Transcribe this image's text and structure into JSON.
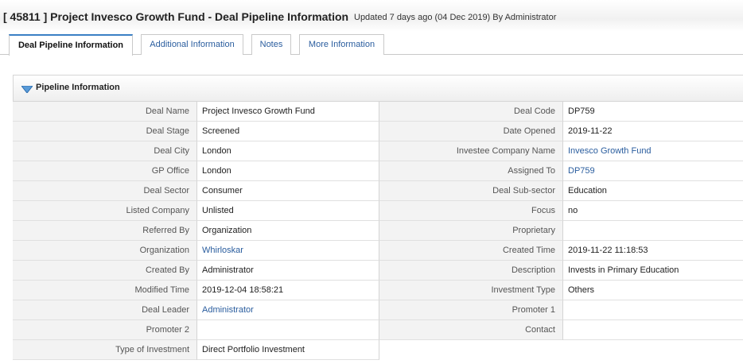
{
  "header": {
    "title": "[ 45811 ] Project Invesco Growth Fund - Deal Pipeline Information",
    "updated": "Updated 7 days ago (04 Dec 2019) By Administrator"
  },
  "tabs": [
    {
      "label": "Deal Pipeline Information"
    },
    {
      "label": "Additional Information"
    },
    {
      "label": "Notes"
    },
    {
      "label": "More Information"
    }
  ],
  "section": {
    "title": "Pipeline Information",
    "icon": "collapse-triangle-icon"
  },
  "rows": [
    {
      "l1": "Deal Name",
      "v1": "Project Invesco Growth Fund",
      "l2": "Deal Code",
      "v2": "DP759"
    },
    {
      "l1": "Deal Stage",
      "v1": "Screened",
      "l2": "Date Opened",
      "v2": "2019-11-22"
    },
    {
      "l1": "Deal City",
      "v1": "London",
      "l2": "Investee Company Name",
      "v2": "Invesco Growth Fund"
    },
    {
      "l1": "GP Office",
      "v1": "London",
      "l2": "Assigned To",
      "v2": "DP759"
    },
    {
      "l1": "Deal Sector",
      "v1": "Consumer",
      "l2": "Deal Sub-sector",
      "v2": "Education"
    },
    {
      "l1": "Listed Company",
      "v1": "Unlisted",
      "l2": "Focus",
      "v2": "no"
    },
    {
      "l1": "Referred By",
      "v1": "Organization",
      "l2": "Proprietary",
      "v2": ""
    },
    {
      "l1": "Organization",
      "v1": "Whirloskar",
      "l2": "Created Time",
      "v2": "2019-11-22 11:18:53"
    },
    {
      "l1": "Created By",
      "v1": "Administrator",
      "l2": "Description",
      "v2": "Invests in Primary Education"
    },
    {
      "l1": "Modified Time",
      "v1": "2019-12-04 18:58:21",
      "l2": "Investment Type",
      "v2": "Others"
    },
    {
      "l1": "Deal Leader",
      "v1": "Administrator",
      "l2": "Promoter 1",
      "v2": ""
    },
    {
      "l1": "Promoter 2",
      "v1": "",
      "l2": "Contact",
      "v2": ""
    },
    {
      "l1": "Type of Investment",
      "v1": "Direct Portfolio Investment"
    }
  ],
  "colors": {
    "link": "#2a5d9e",
    "active_tab_border": "#3b7fc4",
    "label_bg": "#f3f3f3"
  }
}
